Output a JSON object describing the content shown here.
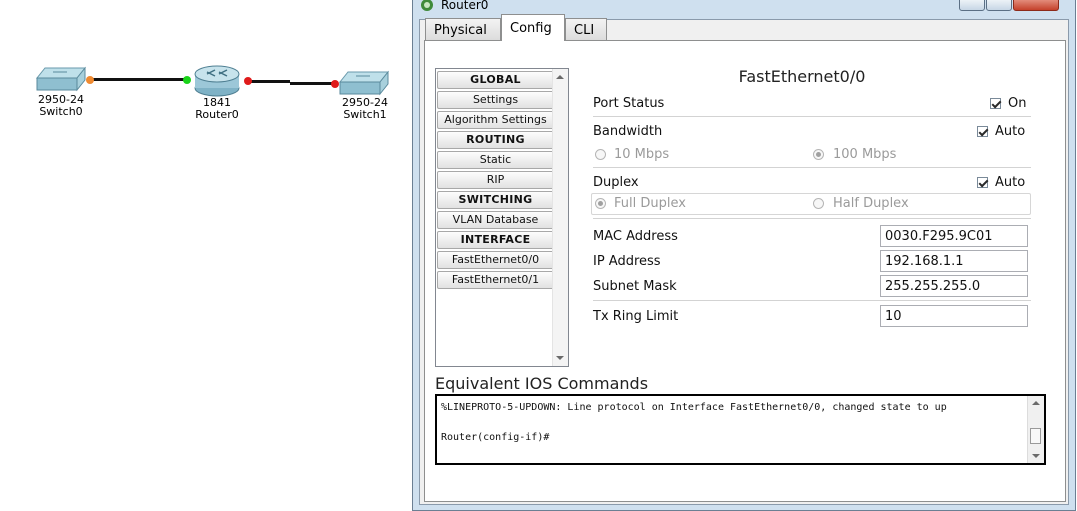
{
  "topology": {
    "devices": [
      {
        "model": "2950-24",
        "name": "Switch0"
      },
      {
        "model": "1841",
        "name": "Router0"
      },
      {
        "model": "2950-24",
        "name": "Switch1"
      }
    ],
    "link_colors": {
      "orange": "#f08a30",
      "green": "#19d419",
      "red": "#e01a1a"
    }
  },
  "window": {
    "title": "Router0",
    "tabs": [
      {
        "label": "Physical"
      },
      {
        "label": "Config",
        "active": true
      },
      {
        "label": "CLI"
      }
    ]
  },
  "nav": {
    "items": [
      {
        "label": "GLOBAL",
        "header": true
      },
      {
        "label": "Settings"
      },
      {
        "label": "Algorithm Settings"
      },
      {
        "label": "ROUTING",
        "header": true
      },
      {
        "label": "Static"
      },
      {
        "label": "RIP"
      },
      {
        "label": "SWITCHING",
        "header": true
      },
      {
        "label": "VLAN Database"
      },
      {
        "label": "INTERFACE",
        "header": true
      },
      {
        "label": "FastEthernet0/0"
      },
      {
        "label": "FastEthernet0/1"
      }
    ]
  },
  "interface": {
    "title": "FastEthernet0/0",
    "port_status": {
      "label": "Port Status",
      "checkbox_label": "On",
      "checked": true
    },
    "bandwidth": {
      "label": "Bandwidth",
      "checkbox_label": "Auto",
      "checked": true,
      "options": [
        {
          "label": "10 Mbps",
          "selected": false
        },
        {
          "label": "100 Mbps",
          "selected": true
        }
      ]
    },
    "duplex": {
      "label": "Duplex",
      "checkbox_label": "Auto",
      "checked": true,
      "options": [
        {
          "label": "Full Duplex",
          "selected": true
        },
        {
          "label": "Half Duplex",
          "selected": false
        }
      ]
    },
    "mac": {
      "label": "MAC Address",
      "value": "0030.F295.9C01"
    },
    "ip": {
      "label": "IP Address",
      "value": "192.168.1.1"
    },
    "mask": {
      "label": "Subnet Mask",
      "value": "255.255.255.0"
    },
    "tx_ring": {
      "label": "Tx Ring Limit",
      "value": "10"
    }
  },
  "ios": {
    "title": "Equivalent IOS Commands",
    "text": "%LINEPROTO-5-UPDOWN: Line protocol on Interface FastEthernet0/0, changed state to up\n\nRouter(config-if)#"
  }
}
